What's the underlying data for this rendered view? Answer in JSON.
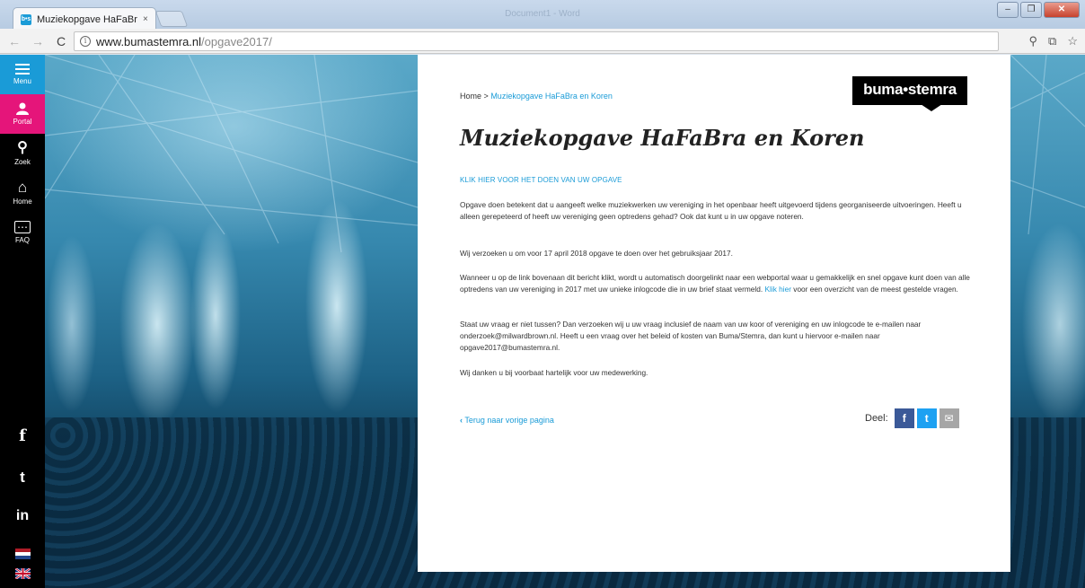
{
  "browser": {
    "tab_title": "Muziekopgave HaFaBra e",
    "tab_favicon": "b•s",
    "tab_close": "×",
    "window_title": "Document1 - Word",
    "url_host": "www.bumastemra.nl",
    "url_path": "/opgave2017/",
    "back_glyph": "←",
    "forward_glyph": "→",
    "reload_glyph": "C",
    "info_glyph": "i",
    "zoom_glyph": "⚲",
    "translate_glyph": "⧉",
    "star_glyph": "☆",
    "win_min": "–",
    "win_max": "❐",
    "win_close": "✕"
  },
  "sidebar": {
    "menu_label": "Menu",
    "portal_label": "Portal",
    "search_label": "Zoek",
    "home_label": "Home",
    "faq_label": "FAQ",
    "search_glyph": "⚲",
    "home_glyph": "⌂",
    "faq_glyph": "⋯",
    "facebook_glyph": "f",
    "twitter_glyph": "t",
    "linkedin_glyph": "in"
  },
  "content": {
    "breadcrumb_home": "Home",
    "breadcrumb_sep": ">",
    "breadcrumb_current": "Muziekopgave HaFaBra en Koren",
    "logo_text": "buma•stemra",
    "title": "Muziekopgave HaFaBra en Koren",
    "cta": "KLIK HIER VOOR HET DOEN VAN UW OPGAVE",
    "p1": "Opgave doen betekent dat u aangeeft welke muziekwerken uw vereniging in het openbaar heeft uitgevoerd tijdens georganiseerde uitvoeringen. Heeft u alleen gerepeteerd of heeft uw vereniging geen optredens gehad? Ook dat kunt u in uw opgave noteren.",
    "p2": "Wij verzoeken u om voor 17 april 2018 opgave te doen over het gebruiksjaar 2017.",
    "p3_a": "Wanneer u op de link bovenaan dit bericht klikt, wordt u automatisch doorgelinkt naar een webportal waar u gemakkelijk en snel opgave kunt doen van alle optredens van uw vereniging in 2017 met uw unieke inlogcode die in uw brief staat vermeld.",
    "p3_link": "Klik hier",
    "p3_b": "voor een overzicht van de meest gestelde vragen.",
    "p4": "Staat uw vraag er niet tussen? Dan verzoeken wij u uw vraag inclusief de naam van uw koor of vereniging en uw inlogcode te e-mailen naar onderzoek@milwardbrown.nl. Heeft u een vraag over het beleid of kosten van Buma/Stemra, dan kunt u hiervoor e-mailen naar opgave2017@bumastemra.nl.",
    "p5": "Wij danken u bij voorbaat hartelijk voor uw medewerking.",
    "back_link": "Terug naar vorige pagina",
    "back_glyph": "‹",
    "share_label": "Deel:",
    "share_facebook": "f",
    "share_twitter": "t",
    "share_mail": "✉"
  }
}
